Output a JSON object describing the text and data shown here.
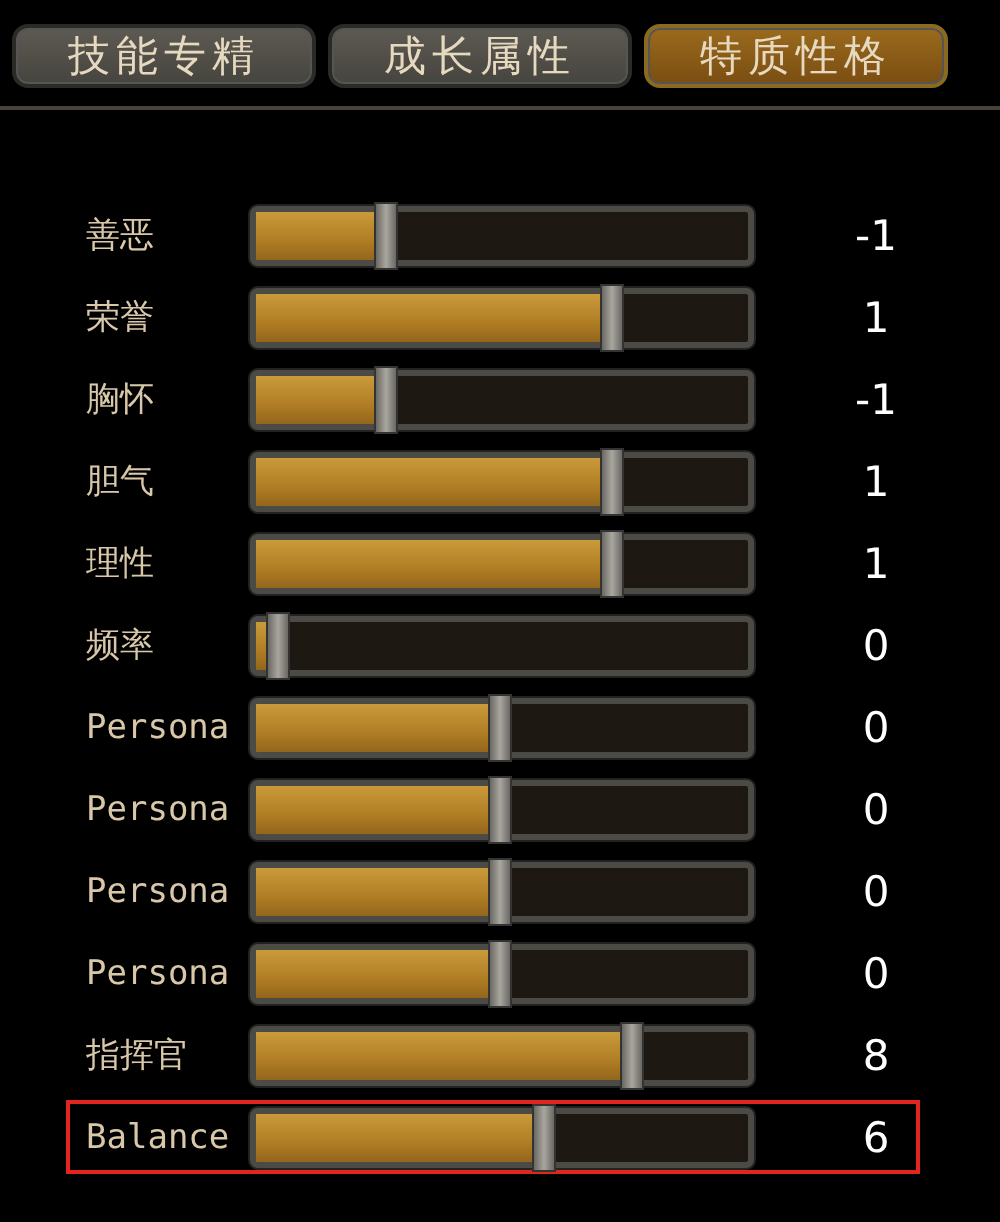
{
  "tabs": [
    {
      "label": "技能专精",
      "selected": false
    },
    {
      "label": "成长属性",
      "selected": false
    },
    {
      "label": "特质性格",
      "selected": true
    }
  ],
  "traits": [
    {
      "name": "善恶",
      "level": 0.26,
      "value": "-1",
      "highlighted": false
    },
    {
      "name": "荣誉",
      "level": 0.72,
      "value": "1",
      "highlighted": false
    },
    {
      "name": "胸怀",
      "level": 0.26,
      "value": "-1",
      "highlighted": false
    },
    {
      "name": "胆气",
      "level": 0.72,
      "value": "1",
      "highlighted": false
    },
    {
      "name": "理性",
      "level": 0.72,
      "value": "1",
      "highlighted": false
    },
    {
      "name": "频率",
      "level": 0.04,
      "value": "0",
      "highlighted": false
    },
    {
      "name": "Persona",
      "level": 0.49,
      "value": "0",
      "highlighted": false
    },
    {
      "name": "Persona",
      "level": 0.49,
      "value": "0",
      "highlighted": false
    },
    {
      "name": "Persona",
      "level": 0.49,
      "value": "0",
      "highlighted": false
    },
    {
      "name": "Persona",
      "level": 0.49,
      "value": "0",
      "highlighted": false
    },
    {
      "name": "指挥官",
      "level": 0.76,
      "value": "8",
      "highlighted": false
    },
    {
      "name": "Balance",
      "level": 0.58,
      "value": "6",
      "highlighted": true
    }
  ]
}
